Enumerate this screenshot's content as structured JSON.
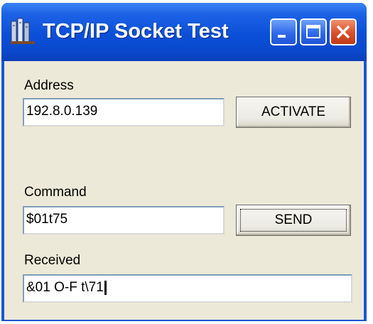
{
  "window": {
    "title": "TCP/IP Socket Test",
    "icons": {
      "app": "network-app-icon",
      "minimize": "minimize-icon",
      "maximize": "maximize-icon",
      "close": "close-icon"
    },
    "colors": {
      "titlebar": "#0b4fd8",
      "close": "#d8502a",
      "client": "#ece9d8"
    }
  },
  "form": {
    "address_label": "Address",
    "address_value": "192.8.0.139",
    "activate_label": "ACTIVATE",
    "command_label": "Command",
    "command_value": "$01t75",
    "send_label": "SEND",
    "received_label": "Received",
    "received_value": "&01  O-F t\\71"
  }
}
